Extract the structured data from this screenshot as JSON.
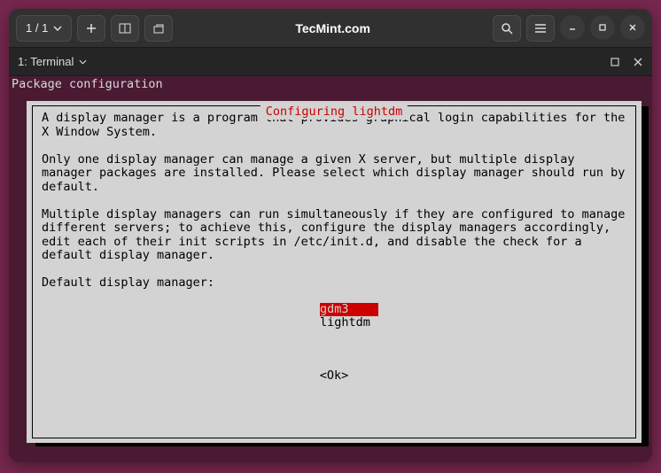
{
  "titlebar": {
    "counter": "1 / 1",
    "title": "TecMint.com"
  },
  "tabbar": {
    "tab_label": "1: Terminal"
  },
  "terminal": {
    "header": "Package configuration"
  },
  "dialog": {
    "title": " Configuring lightdm ",
    "para1": "A display manager is a program that provides graphical login capabilities for the X Window System.",
    "para2": "Only one display manager can manage a given X server, but multiple display manager packages are installed. Please select which display manager should run by default.",
    "para3": "Multiple display managers can run simultaneously if they are configured to manage different servers; to achieve this, configure the display managers accordingly, edit each of their init scripts in /etc/init.d, and disable the check for a default display manager.",
    "prompt": "Default display manager:",
    "options": {
      "opt1": "gdm3",
      "opt2": "lightdm"
    },
    "ok": "<Ok>"
  }
}
